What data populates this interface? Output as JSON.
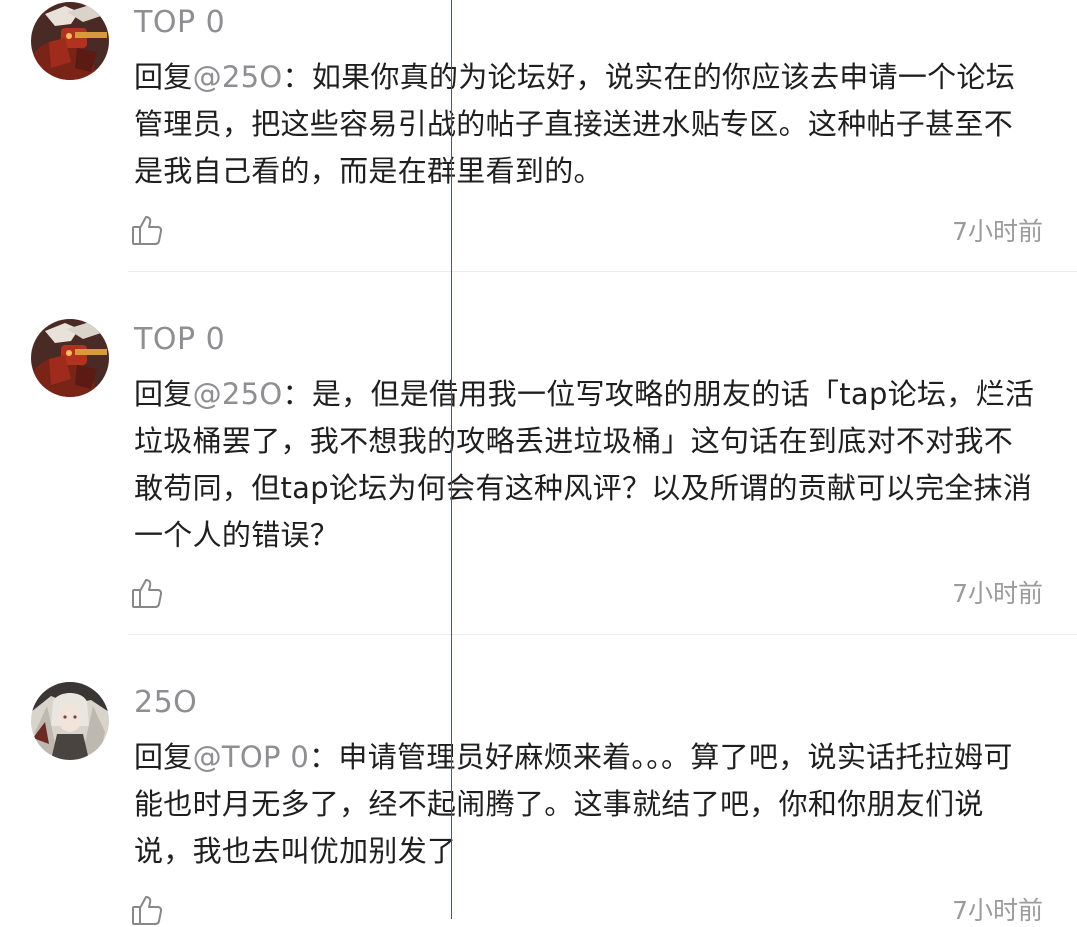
{
  "replies": [
    {
      "username": "TOP  0",
      "reply_prefix": "回复",
      "mention": "@25O",
      "separator": "：",
      "text": "如果你真的为论坛好，说实在的你应该去申请一个论坛管理员，把这些容易引战的帖子直接送进水贴专区。这种帖子甚至不是我自己看的，而是在群里看到的。",
      "time": "7小时前",
      "avatar_icon": "avatar-mecha-character-icon",
      "like_icon": "thumbs-up-icon"
    },
    {
      "username": "TOP  0",
      "reply_prefix": "回复",
      "mention": "@25O",
      "separator": "：",
      "text": "是，但是借用我一位写攻略的朋友的话「tap论坛，烂活垃圾桶罢了，我不想我的攻略丢进垃圾桶」这句话在到底对不对我不敢苟同，但tap论坛为何会有这种风评？以及所谓的贡献可以完全抹消一个人的错误？",
      "time": "7小时前",
      "avatar_icon": "avatar-mecha-character-icon",
      "like_icon": "thumbs-up-icon"
    },
    {
      "username": "25O",
      "reply_prefix": "回复",
      "mention": "@TOP  0",
      "separator": "：",
      "text": "申请管理员好麻烦来着。。。算了吧，说实话托拉姆可能也时月无多了，经不起闹腾了。这事就结了吧，你和你朋友们说说，我也去叫优加别发了",
      "time": "7小时前",
      "avatar_icon": "avatar-silver-hair-character-icon",
      "like_icon": "thumbs-up-icon"
    }
  ],
  "colors": {
    "text": "#1f1f1f",
    "muted": "#8e8e93",
    "time": "#9b9b9b",
    "divider": "#ececec",
    "guide_line": "#3a5d86"
  }
}
